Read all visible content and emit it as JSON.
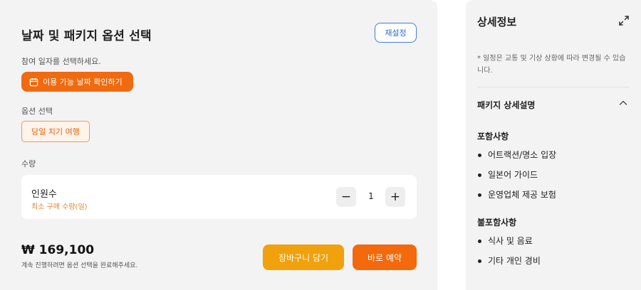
{
  "booking": {
    "title": "날짜 및 패키지 옵션 선택",
    "reset_label": "재설정",
    "date_hint": "참여 일자를 선택하세요.",
    "date_button_label": "이용 가능 날짜 확인하기",
    "option_label": "옵션 선택",
    "option_chip_label": "당일 치기 여행",
    "quantity_label": "수량",
    "quantity": {
      "title": "인원수",
      "subtitle": "최소 구매 수량(일)",
      "minus": "−",
      "value": "1",
      "plus": "+"
    },
    "price": "₩ 169,100",
    "price_note": "계속 진행하려면 옵션 선택을 완료해주세요.",
    "cart_label": "장바구니 담기",
    "book_label": "바로 예약"
  },
  "details": {
    "title": "상세정보",
    "note": "* 일정은 교통 및 기상 상황에 따라 변경될 수 있습니다.",
    "package_title": "패키지 상세설명",
    "included_heading": "포함사항",
    "included": [
      "어트랙션/명소 입장",
      "일본어 가이드",
      "운영업체 제공 보험"
    ],
    "excluded_heading": "불포함사항",
    "excluded": [
      "식사 및 음료",
      "기타 개인 경비"
    ]
  },
  "colors": {
    "accent_orange": "#f3690c",
    "cart_yellow": "#f0a10c",
    "reset_blue": "#2f6ad4",
    "panel_bg": "#f3f3f4"
  },
  "icons": {
    "date_button": "calendar-icon",
    "expand": "expand-icon",
    "package_toggle": "chevron-up-icon"
  }
}
